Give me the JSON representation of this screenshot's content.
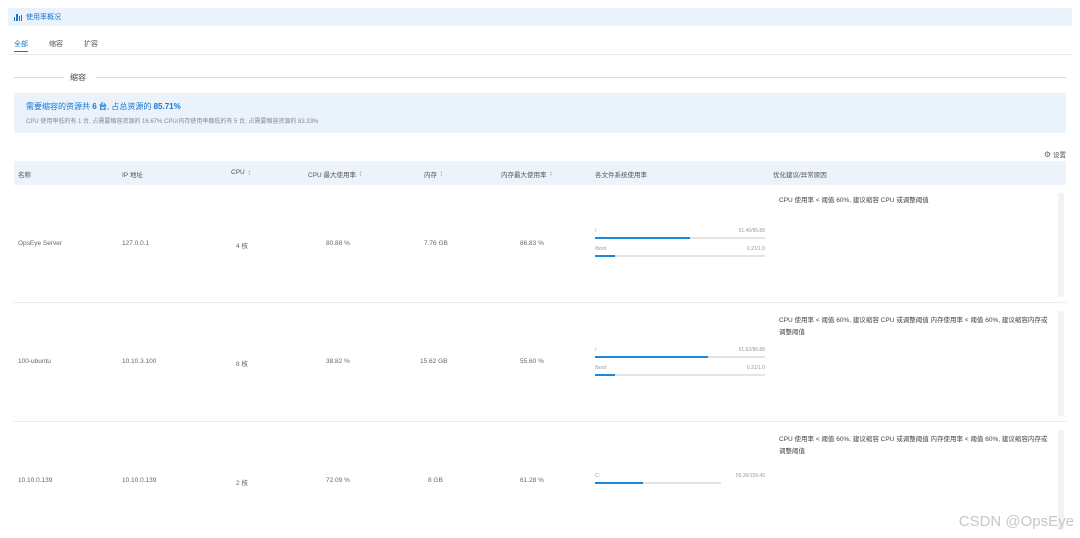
{
  "header": {
    "title": "使用率概况"
  },
  "tabs": [
    {
      "label": "全部",
      "active": true
    },
    {
      "label": "缩容",
      "active": false
    },
    {
      "label": "扩容",
      "active": false
    }
  ],
  "section": {
    "title": "缩容"
  },
  "summary": {
    "main_prefix": "需要缩容的资源共",
    "count": "6 台",
    "main_mid": ", 占总资源的",
    "percent": "85.71%",
    "sub": "CPU 使用率低的有 1 台, 占需要缩容资源的 16.67% CPU/内存使用率都低的有 5 台, 占需要缩容资源的 83.33%"
  },
  "settings": {
    "label": "设置",
    "icon": "gear-icon"
  },
  "table": {
    "headers": {
      "name": "名称",
      "ip": "IP 地址",
      "cpu": "CPU",
      "cpu_max": "CPU 最大使用率",
      "mem": "内存",
      "mem_max": "内存最大使用率",
      "fs": "各文件系统使用率",
      "advice": "优化建议/异常原因"
    },
    "rows": [
      {
        "name": "OpsEye Server",
        "ip": "127.0.0.1",
        "cpu": "4 核",
        "cpu_max": "80.88 %",
        "mem": "7.76 GB",
        "mem_max": "86.83 %",
        "fs": [
          {
            "mount": "/",
            "value": "51.46/96.88",
            "ratio": 0.53
          },
          {
            "mount": "/boot",
            "value": "0.21/1.0",
            "ratio": 0.21
          }
        ],
        "advice": "CPU 使用率 < 阈值 60%, 建议缩容 CPU 或调整阈值"
      },
      {
        "name": "100-ubuntu",
        "ip": "10.10.3.100",
        "cpu": "8 核",
        "cpu_max": "38.82 %",
        "mem": "15.62 GB",
        "mem_max": "55.60 %",
        "fs": [
          {
            "mount": "/",
            "value": "61.52/96.88",
            "ratio": 0.66
          },
          {
            "mount": "/boot",
            "value": "0.21/1.0",
            "ratio": 0.21
          }
        ],
        "advice": "CPU 使用率 < 阈值 60%, 建议缩容 CPU 或调整阈值 内存使用率 < 阈值 60%, 建议缩容内存或调整阈值"
      },
      {
        "name": "10.10.0.139",
        "ip": "10.10.0.139",
        "cpu": "2 核",
        "cpu_max": "72.09 %",
        "mem": "8 GB",
        "mem_max": "61.28 %",
        "fs": [
          {
            "mount": "C:",
            "value": "56.36/159.45",
            "ratio": 0.35
          }
        ],
        "advice": "CPU 使用率 < 阈值 60%, 建议缩容 CPU 或调整阈值 内存使用率 < 阈值 60%, 建议缩容内存或调整阈值"
      }
    ]
  },
  "watermark": "CSDN @OpsEye",
  "colors": {
    "accent": "#1677d2",
    "bar": "#1e88d8",
    "header_bg": "#eaf2fb"
  }
}
